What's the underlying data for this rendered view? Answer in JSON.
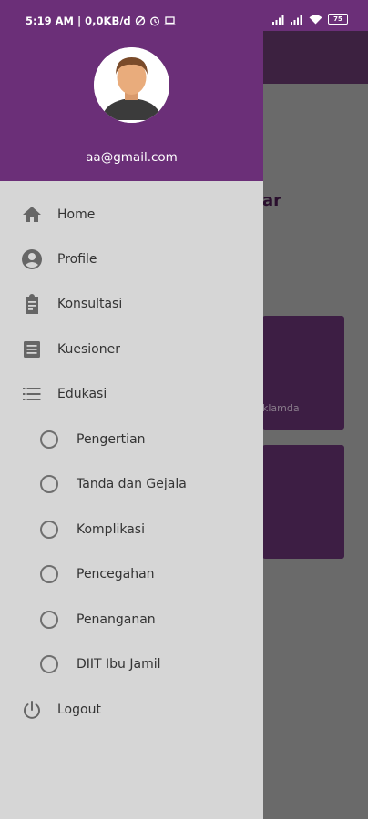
{
  "status_bar": {
    "time_info": "5:19 AM | 0,0KB/d",
    "battery": "75"
  },
  "background": {
    "title_fragment": "ar",
    "card_text": "klamda"
  },
  "drawer": {
    "email": "aa@gmail.com",
    "menu": [
      {
        "label": "Home",
        "icon": "home-icon"
      },
      {
        "label": "Profile",
        "icon": "account-circle-icon"
      },
      {
        "label": "Konsultasi",
        "icon": "clipboard-icon"
      },
      {
        "label": "Kuesioner",
        "icon": "list-box-icon"
      },
      {
        "label": "Edukasi",
        "icon": "list-icon"
      }
    ],
    "edukasi_items": [
      {
        "label": "Pengertian"
      },
      {
        "label": "Tanda dan Gejala"
      },
      {
        "label": "Komplikasi"
      },
      {
        "label": "Pencegahan"
      },
      {
        "label": "Penanganan"
      },
      {
        "label": "DIIT Ibu Jamil"
      }
    ],
    "logout": {
      "label": "Logout",
      "icon": "power-icon"
    }
  }
}
